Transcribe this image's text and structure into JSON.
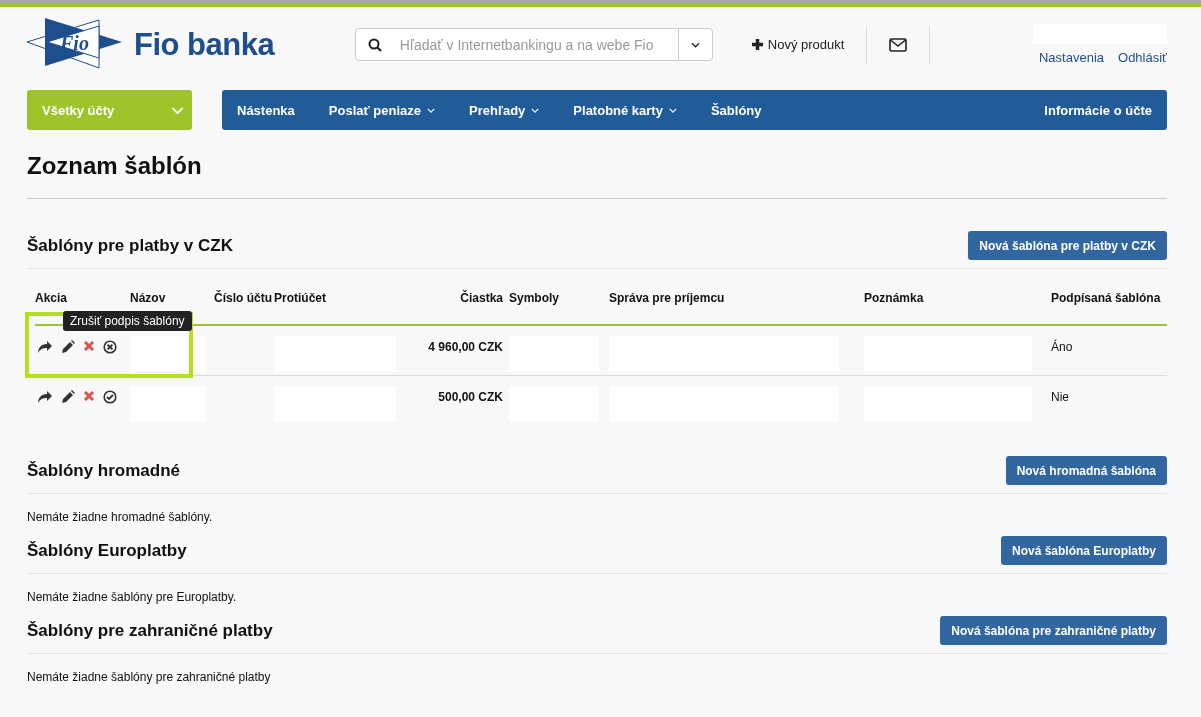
{
  "header": {
    "logo_mark": "Fio",
    "logo_text": "Fio banka",
    "search": {
      "placeholder": "Hľadať v Internetbankingu a na webe Fio"
    },
    "new_product": "Nový produkt",
    "user_masked": true,
    "links": [
      "Nastavenia",
      "Odhlásiť"
    ]
  },
  "accounts_menu": {
    "label": "Všetky účty"
  },
  "nav": {
    "items": [
      {
        "label": "Nástenka",
        "dropdown": false
      },
      {
        "label": "Poslať peniaze",
        "dropdown": true
      },
      {
        "label": "Prehľady",
        "dropdown": true
      },
      {
        "label": "Platobné karty",
        "dropdown": true
      },
      {
        "label": "Šablóny",
        "dropdown": false
      }
    ],
    "right": "Informácie o účte"
  },
  "page_title": "Zoznam šablón",
  "czk": {
    "title": "Šablóny pre platby v CZK",
    "button": "Nová šablóna pre platby v CZK",
    "columns": [
      "Akcia",
      "Názov",
      "Číslo účtu",
      "Protiúčet",
      "Čiastka",
      "Symboly",
      "Správa pre príjemcu",
      "Poznámka",
      "Podpísaná šablóna"
    ],
    "rows": [
      {
        "amount": "4 960,00 CZK",
        "signed_text": "Áno",
        "signed": true,
        "highlighted": true,
        "tooltip": "Zrušiť podpis šablóny",
        "name_masked": true,
        "counter_masked": true,
        "symbols_masked": true,
        "message_masked": true,
        "note_masked": true
      },
      {
        "amount": "500,00 CZK",
        "signed_text": "Nie",
        "signed": false,
        "highlighted": false,
        "name_masked": true,
        "counter_masked": true,
        "symbols_masked": true,
        "message_masked": true,
        "note_masked": true
      }
    ]
  },
  "sections": [
    {
      "title": "Šablóny hromadné",
      "button": "Nová hromadná šablóna",
      "empty": "Nemáte žiadne hromadné šablóny."
    },
    {
      "title": "Šablóny Europlatby",
      "button": "Nová šablóna Europlatby",
      "empty": "Nemáte žiadne šablóny pre Europlatby."
    },
    {
      "title": "Šablóny pre zahraničné platby",
      "button": "Nová šablóna pre zahraničné platby",
      "empty": "Nemáte žiadne šablóny pre zahraničné platby"
    }
  ]
}
